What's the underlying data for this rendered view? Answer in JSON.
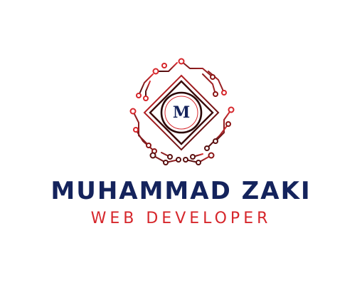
{
  "logo": {
    "initial": "M",
    "name": "MUHAMMAD ZAKI",
    "title": "WEB DEVELOPER"
  },
  "colors": {
    "navy": "#14235c",
    "red": "#d6262b",
    "dark_red": "#5a1010",
    "background": "#ffffff"
  },
  "icons": {
    "emblem": "circuit-board-emblem-icon"
  }
}
